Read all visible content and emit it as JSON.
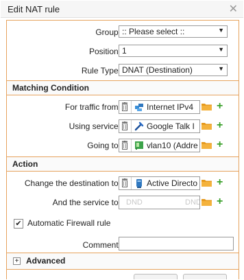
{
  "window": {
    "title": "Edit NAT rule",
    "close_glyph": "✕"
  },
  "fields": {
    "group": {
      "label": "Group:",
      "value": ":: Please select ::"
    },
    "position": {
      "label": "Position:",
      "value": "1"
    },
    "rule_type": {
      "label": "Rule Type:",
      "value": "DNAT (Destination)"
    }
  },
  "matching": {
    "header": "Matching Condition",
    "traffic_from": {
      "label": "For traffic from:",
      "value": "Internet IPv4",
      "icon": "network-icon"
    },
    "service": {
      "label": "Using service:",
      "value": "Google Talk I",
      "icon": "service-icon"
    },
    "going_to": {
      "label": "Going to:",
      "value": "vlan10 (Addre",
      "icon": "interface-address-icon"
    }
  },
  "action": {
    "header": "Action",
    "change_destination": {
      "label": "Change the destination to:",
      "value": "Active Directo",
      "icon": "host-icon"
    },
    "service_to": {
      "label": "And the service to:",
      "placeholder_left": "DND",
      "placeholder_right": "DND"
    }
  },
  "firewall": {
    "label": "Automatic Firewall rule",
    "checked": "✔"
  },
  "comment": {
    "label": "Comment:",
    "value": ""
  },
  "advanced": {
    "label": "Advanced",
    "toggle": "+"
  },
  "colors": {
    "accent_border": "#e6a25d",
    "add_green": "#3ba12c",
    "folder_orange": "#e69a1e"
  }
}
